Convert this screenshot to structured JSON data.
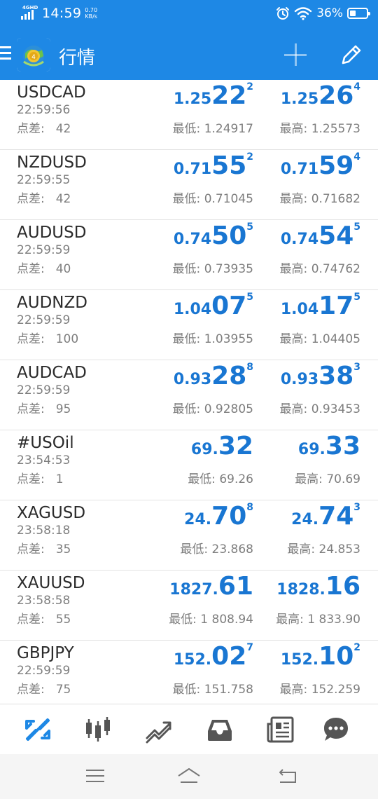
{
  "status_bar": {
    "network": "4GHD",
    "time": "14:59",
    "speed_value": "0.70",
    "speed_unit": "KB/s",
    "battery_percent": "36%",
    "battery_level": 0.36
  },
  "app_bar": {
    "title": "行情"
  },
  "labels": {
    "spread": "点差:",
    "low": "最低:",
    "high": "最高:"
  },
  "colors": {
    "primary": "#1e88e5",
    "price": "#1976d2",
    "muted": "#7e7e7e"
  },
  "quotes": [
    {
      "symbol": "USDCAD",
      "time": "22:59:56",
      "spread": "42",
      "bid": {
        "small": "1.25",
        "big": "22",
        "pip": "2"
      },
      "ask": {
        "small": "1.25",
        "big": "26",
        "pip": "4"
      },
      "low": "1.24917",
      "high": "1.25573"
    },
    {
      "symbol": "NZDUSD",
      "time": "22:59:55",
      "spread": "42",
      "bid": {
        "small": "0.71",
        "big": "55",
        "pip": "2"
      },
      "ask": {
        "small": "0.71",
        "big": "59",
        "pip": "4"
      },
      "low": "0.71045",
      "high": "0.71682"
    },
    {
      "symbol": "AUDUSD",
      "time": "22:59:59",
      "spread": "40",
      "bid": {
        "small": "0.74",
        "big": "50",
        "pip": "5"
      },
      "ask": {
        "small": "0.74",
        "big": "54",
        "pip": "5"
      },
      "low": "0.73935",
      "high": "0.74762"
    },
    {
      "symbol": "AUDNZD",
      "time": "22:59:59",
      "spread": "100",
      "bid": {
        "small": "1.04",
        "big": "07",
        "pip": "5"
      },
      "ask": {
        "small": "1.04",
        "big": "17",
        "pip": "5"
      },
      "low": "1.03955",
      "high": "1.04405"
    },
    {
      "symbol": "AUDCAD",
      "time": "22:59:59",
      "spread": "95",
      "bid": {
        "small": "0.93",
        "big": "28",
        "pip": "8"
      },
      "ask": {
        "small": "0.93",
        "big": "38",
        "pip": "3"
      },
      "low": "0.92805",
      "high": "0.93453"
    },
    {
      "symbol": "#USOil",
      "time": "23:54:53",
      "spread": "1",
      "bid": {
        "small": "69.",
        "big": "32",
        "pip": ""
      },
      "ask": {
        "small": "69.",
        "big": "33",
        "pip": ""
      },
      "low": "69.26",
      "high": "70.69"
    },
    {
      "symbol": "XAGUSD",
      "time": "23:58:18",
      "spread": "35",
      "bid": {
        "small": "24.",
        "big": "70",
        "pip": "8"
      },
      "ask": {
        "small": "24.",
        "big": "74",
        "pip": "3"
      },
      "low": "23.868",
      "high": "24.853"
    },
    {
      "symbol": "XAUUSD",
      "time": "23:58:58",
      "spread": "55",
      "bid": {
        "small": "1827.",
        "big": "61",
        "pip": ""
      },
      "ask": {
        "small": "1828.",
        "big": "16",
        "pip": ""
      },
      "low": "1 808.94",
      "high": "1 833.90"
    },
    {
      "symbol": "GBPJPY",
      "time": "22:59:59",
      "spread": "75",
      "bid": {
        "small": "152.",
        "big": "02",
        "pip": "7"
      },
      "ask": {
        "small": "152.",
        "big": "10",
        "pip": "2"
      },
      "low": "151.758",
      "high": "152.259"
    }
  ],
  "bottom_nav": [
    {
      "icon": "quotes-icon",
      "active": true
    },
    {
      "icon": "candlestick-chart-icon",
      "active": false
    },
    {
      "icon": "trade-icon",
      "active": false
    },
    {
      "icon": "history-inbox-icon",
      "active": false
    },
    {
      "icon": "news-icon",
      "active": false
    },
    {
      "icon": "chat-icon",
      "active": false
    }
  ],
  "system_nav": [
    {
      "icon": "menu-icon"
    },
    {
      "icon": "home-icon"
    },
    {
      "icon": "back-icon"
    }
  ]
}
